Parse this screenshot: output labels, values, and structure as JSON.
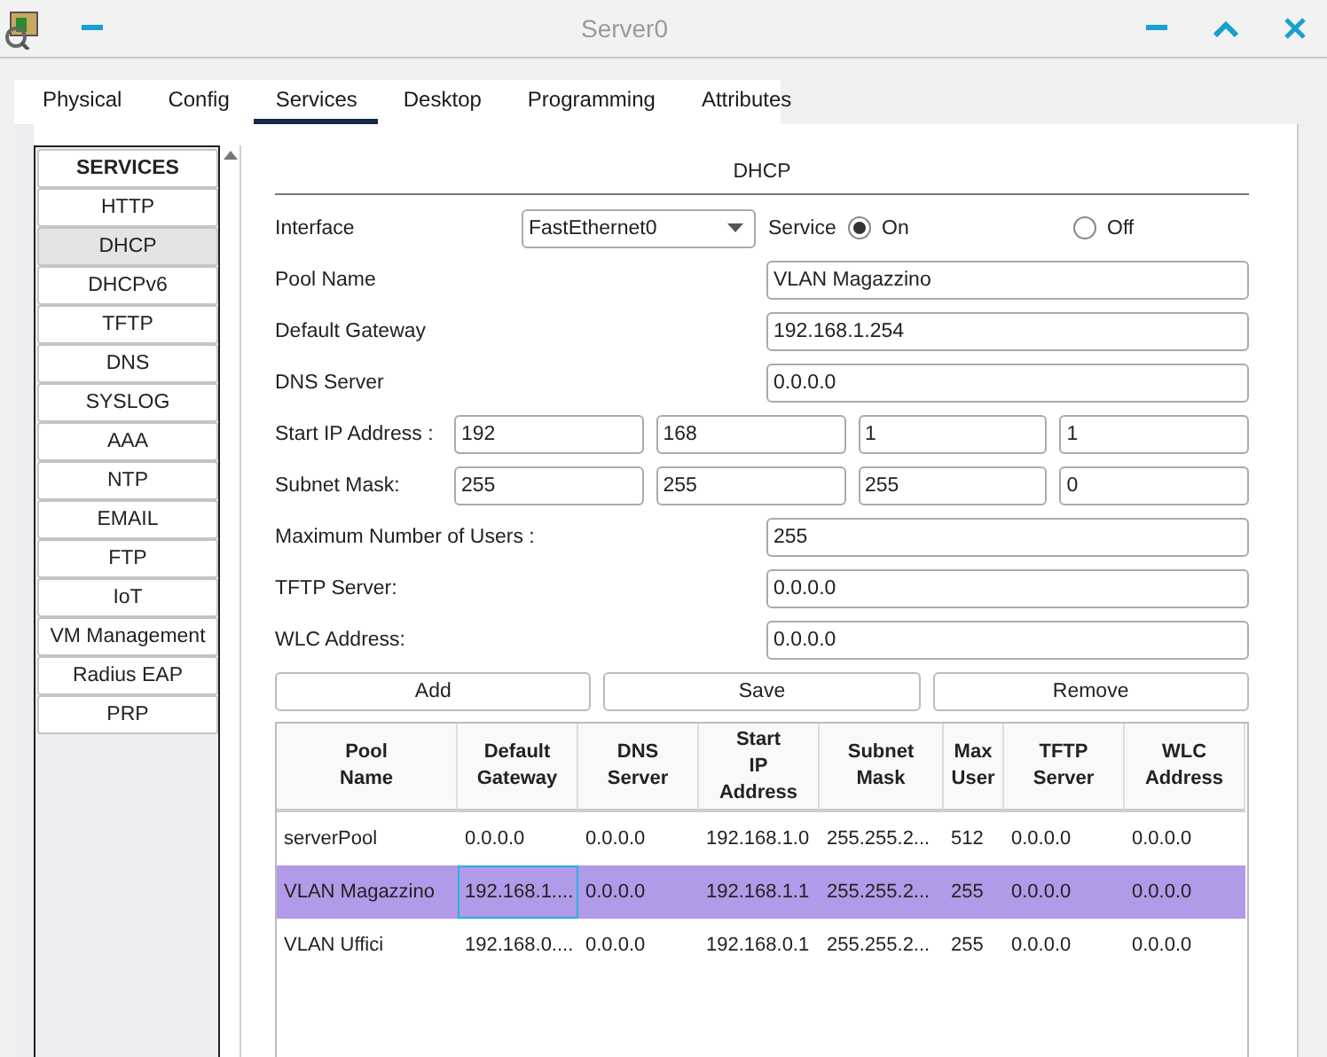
{
  "window": {
    "title": "Server0"
  },
  "tabs": [
    {
      "label": "Physical",
      "selected": false
    },
    {
      "label": "Config",
      "selected": false
    },
    {
      "label": "Services",
      "selected": true
    },
    {
      "label": "Desktop",
      "selected": false
    },
    {
      "label": "Programming",
      "selected": false
    },
    {
      "label": "Attributes",
      "selected": false
    }
  ],
  "services": {
    "heading": "SERVICES",
    "items": [
      {
        "label": "HTTP",
        "selected": false
      },
      {
        "label": "DHCP",
        "selected": true
      },
      {
        "label": "DHCPv6",
        "selected": false
      },
      {
        "label": "TFTP",
        "selected": false
      },
      {
        "label": "DNS",
        "selected": false
      },
      {
        "label": "SYSLOG",
        "selected": false
      },
      {
        "label": "AAA",
        "selected": false
      },
      {
        "label": "NTP",
        "selected": false
      },
      {
        "label": "EMAIL",
        "selected": false
      },
      {
        "label": "FTP",
        "selected": false
      },
      {
        "label": "IoT",
        "selected": false
      },
      {
        "label": "VM Management",
        "selected": false
      },
      {
        "label": "Radius EAP",
        "selected": false
      },
      {
        "label": "PRP",
        "selected": false
      }
    ]
  },
  "dhcp": {
    "title": "DHCP",
    "interface": {
      "label": "Interface",
      "value": "FastEthernet0"
    },
    "service": {
      "label": "Service",
      "options": [
        {
          "label": "On",
          "selected": true
        },
        {
          "label": "Off",
          "selected": false
        }
      ]
    },
    "fields": [
      {
        "kind": "text",
        "label": "Pool Name",
        "value": "VLAN Magazzino"
      },
      {
        "kind": "text",
        "label": "Default Gateway",
        "value": "192.168.1.254"
      },
      {
        "kind": "text",
        "label": "DNS Server",
        "value": "0.0.0.0"
      },
      {
        "kind": "octets",
        "label": "Start IP Address :",
        "values": [
          "192",
          "168",
          "1",
          "1"
        ]
      },
      {
        "kind": "octets",
        "label": "Subnet Mask:",
        "values": [
          "255",
          "255",
          "255",
          "0"
        ]
      },
      {
        "kind": "text",
        "label": "Maximum Number of Users :",
        "value": "255"
      },
      {
        "kind": "text",
        "label": "TFTP Server:",
        "value": "0.0.0.0"
      },
      {
        "kind": "text",
        "label": "WLC Address:",
        "value": "0.0.0.0"
      }
    ],
    "buttons": [
      "Add",
      "Save",
      "Remove"
    ],
    "table": {
      "columns": [
        "Pool Name",
        "Default Gateway",
        "DNS Server",
        "Start IP Address",
        "Subnet Mask",
        "Max User",
        "TFTP Server",
        "WLC Address"
      ],
      "rows": [
        {
          "selected": false,
          "cells": [
            "serverPool",
            "0.0.0.0",
            "0.0.0.0",
            "192.168.1.0",
            "255.255.2...",
            "512",
            "0.0.0.0",
            "0.0.0.0"
          ]
        },
        {
          "selected": true,
          "cells": [
            "VLAN Magazzino",
            "192.168.1....",
            "0.0.0.0",
            "192.168.1.1",
            "255.255.2...",
            "255",
            "0.0.0.0",
            "0.0.0.0"
          ]
        },
        {
          "selected": false,
          "cells": [
            "VLAN Uffici",
            "192.168.0....",
            "0.0.0.0",
            "192.168.0.1",
            "255.255.2...",
            "255",
            "0.0.0.0",
            "0.0.0.0"
          ]
        }
      ]
    }
  }
}
